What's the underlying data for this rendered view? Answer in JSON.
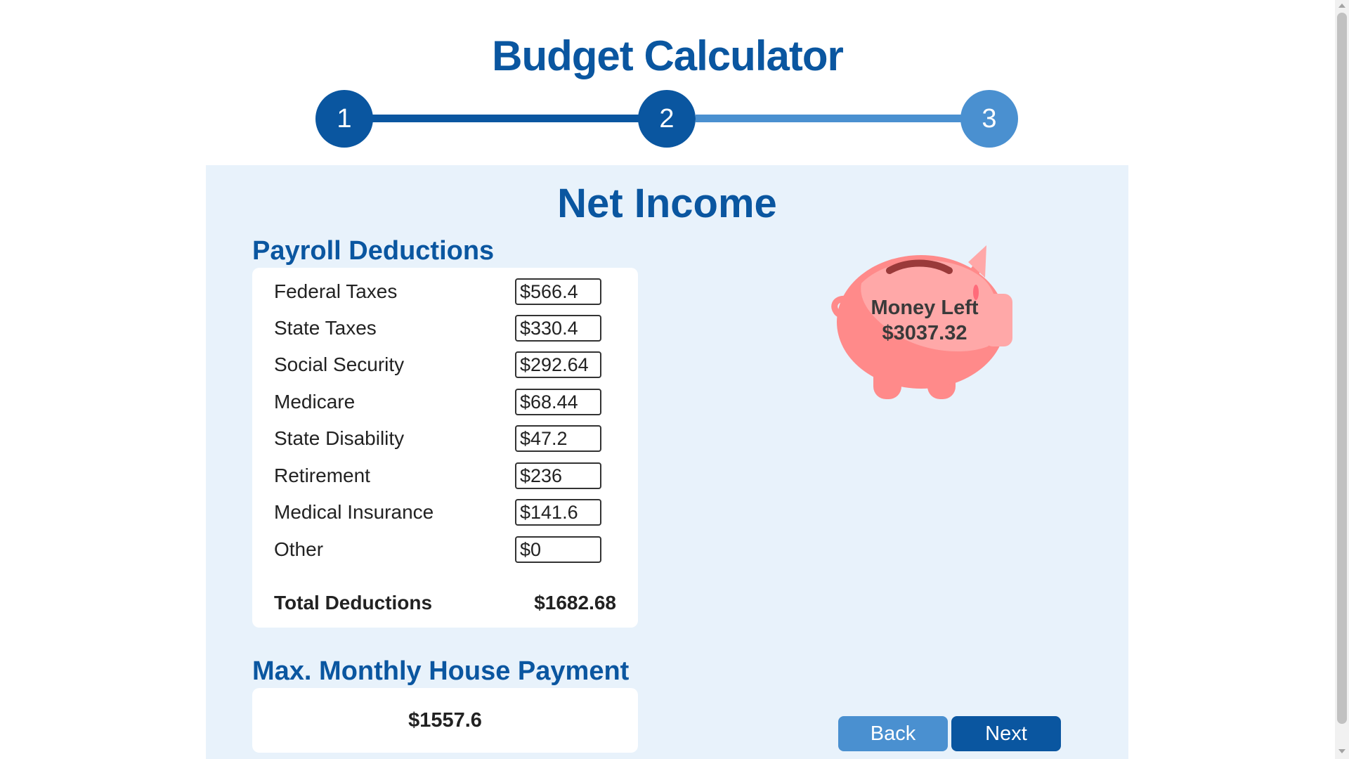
{
  "app": {
    "title": "Budget Calculator"
  },
  "stepper": {
    "steps": [
      {
        "label": "1",
        "state": "complete"
      },
      {
        "label": "2",
        "state": "current"
      },
      {
        "label": "3",
        "state": "upcoming"
      }
    ],
    "colors": {
      "active": "#0a56a0",
      "inactive": "#4a90d0"
    }
  },
  "main": {
    "section_title": "Net Income",
    "payroll": {
      "heading": "Payroll Deductions",
      "items": [
        {
          "label": "Federal Taxes",
          "value": "$566.4"
        },
        {
          "label": "State Taxes",
          "value": "$330.4"
        },
        {
          "label": "Social Security",
          "value": "$292.64"
        },
        {
          "label": "Medicare",
          "value": "$68.44"
        },
        {
          "label": "State Disability",
          "value": "$47.2"
        },
        {
          "label": "Retirement",
          "value": "$236"
        },
        {
          "label": "Medical Insurance",
          "value": "$141.6"
        },
        {
          "label": "Other",
          "value": "$0"
        }
      ],
      "total_label": "Total Deductions",
      "total_value": "$1682.68"
    },
    "house_payment": {
      "heading": "Max. Monthly House Payment",
      "value": "$1557.6"
    },
    "piggy": {
      "icon": "piggy-bank-icon",
      "label": "Money Left",
      "value": "$3037.32",
      "color": "#ff8a8a"
    }
  },
  "buttons": {
    "back": "Back",
    "next": "Next"
  }
}
